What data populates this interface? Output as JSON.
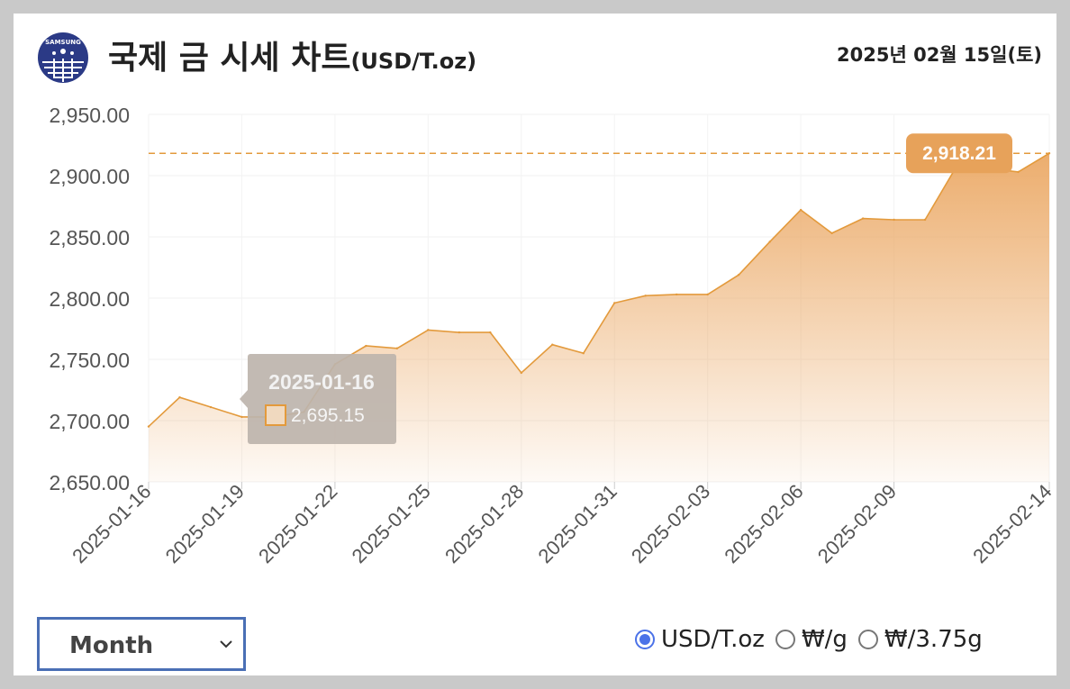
{
  "header": {
    "title": "국제 금 시세 차트",
    "title_unit": "(USD/T.oz)",
    "date": "2025년 02월 15일(토)",
    "logo_icon": "samsung-gold-globe-logo",
    "logo_text": "SAMSUNG"
  },
  "controls": {
    "period_select": {
      "selected": "Month",
      "icon": "chevron-down-icon"
    },
    "units": [
      {
        "label": "USD/T.oz",
        "checked": true
      },
      {
        "label": "₩/g",
        "checked": false
      },
      {
        "label": "₩/3.75g",
        "checked": false
      }
    ]
  },
  "colors": {
    "line": "#e39a3c",
    "fill_top": "#eba966",
    "badge": "#e7a25a",
    "tooltip_bg": "#bdb4ac",
    "accent": "#4b72e8"
  },
  "chart_data": {
    "type": "area",
    "x": [
      "2025-01-16",
      "2025-01-17",
      "2025-01-18",
      "2025-01-19",
      "2025-01-20",
      "2025-01-21",
      "2025-01-22",
      "2025-01-23",
      "2025-01-24",
      "2025-01-25",
      "2025-01-26",
      "2025-01-27",
      "2025-01-28",
      "2025-01-29",
      "2025-01-30",
      "2025-01-31",
      "2025-02-01",
      "2025-02-02",
      "2025-02-03",
      "2025-02-04",
      "2025-02-05",
      "2025-02-06",
      "2025-02-07",
      "2025-02-08",
      "2025-02-09",
      "2025-02-10",
      "2025-02-11",
      "2025-02-12",
      "2025-02-13",
      "2025-02-14"
    ],
    "values": [
      2695.15,
      2719,
      2711,
      2703,
      2703,
      2707,
      2746,
      2761,
      2759,
      2774,
      2772,
      2772,
      2739,
      2762,
      2755,
      2796,
      2802,
      2803,
      2803,
      2819,
      2846,
      2872,
      2853,
      2865,
      2864,
      2864,
      2907,
      2906,
      2903,
      2918.21
    ],
    "x_tick_labels": [
      "2025-01-16",
      "2025-01-19",
      "2025-01-22",
      "2025-01-25",
      "2025-01-28",
      "2025-01-31",
      "2025-02-03",
      "2025-02-06",
      "2025-02-09",
      "2025-02-14"
    ],
    "y_tick_labels": [
      "2,950.00",
      "2,900.00",
      "2,850.00",
      "2,800.00",
      "2,750.00",
      "2,700.00",
      "2,650.00"
    ],
    "ylim": [
      2650,
      2950
    ],
    "grid": true,
    "reference_line": {
      "value": 2918.21,
      "label": "2,918.21"
    },
    "tooltip": {
      "date": "2025-01-16",
      "value": "2,695.15"
    }
  }
}
